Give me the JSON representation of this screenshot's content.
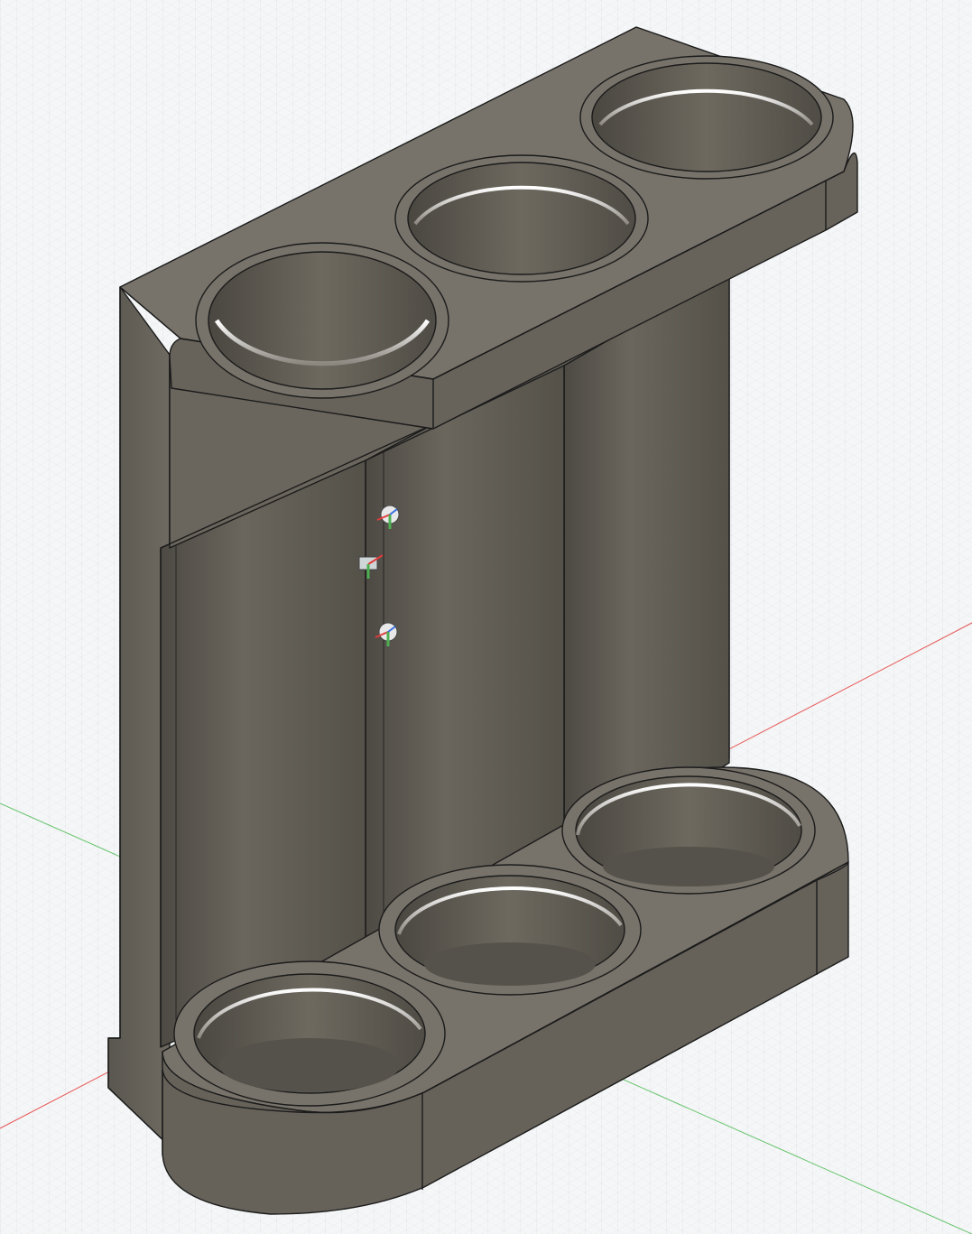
{
  "viewport": {
    "background": "#f5f6f7",
    "grid_minor_color": "#e4e6e8",
    "grid_major_color": "#d3d6d9",
    "x_axis_color": "#e8595a",
    "y_axis_color": "#64c36a"
  },
  "model": {
    "body_color": "#6b675d",
    "face_light": "#78746a",
    "face_dark": "#4f4c45",
    "edge_color": "#1b1b1b",
    "highlight": "#ffffff",
    "top_holes": 3,
    "bottom_holes": 3
  },
  "joint_markers": [
    {
      "name": "joint-marker-1",
      "icon": "joint-origin-icon"
    },
    {
      "name": "joint-marker-2",
      "icon": "component-joint-icon"
    },
    {
      "name": "joint-marker-3",
      "icon": "joint-origin-icon"
    }
  ]
}
